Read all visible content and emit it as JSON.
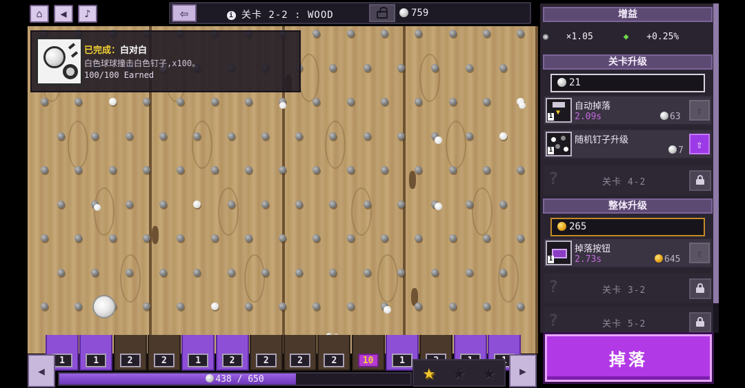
{
  "topbar": {
    "home_icon": "home-icon",
    "sound_icon": "speaker-icon",
    "music_icon": "music-note-icon",
    "back_icon": "arrow-left-icon",
    "level_title": "关卡 2-2 : WOOD",
    "ball_count": "759"
  },
  "achievement": {
    "status": "已完成：",
    "name": "白对白",
    "description": "白色球球撞击白色钉子,x100。",
    "progress": "100/100 Earned"
  },
  "board": {
    "bonus_marker": "2"
  },
  "slots": {
    "values": [
      "1",
      "1",
      "2",
      "2",
      "1",
      "2",
      "2",
      "2",
      "2",
      "10",
      "1",
      "2",
      "1",
      "1"
    ],
    "highlighted": [
      0,
      1,
      4,
      5,
      10,
      12,
      13
    ]
  },
  "progress": {
    "text": "438 / 650",
    "fraction": 0.674
  },
  "stars": {
    "earned": 1,
    "total": 3
  },
  "panel": {
    "boost_header": "增益",
    "boost_ball": "×1.05",
    "boost_gem": "+0.25%",
    "level_upgrade_header": "关卡升级",
    "level_coins": "21",
    "upgrades": [
      {
        "name": "自动掉落",
        "time": "2.09s",
        "cost": "63",
        "icon": "auto-drop-icon"
      },
      {
        "name": "随机钉子升级",
        "time": "",
        "cost": "7",
        "icon": "random-peg-icon"
      }
    ],
    "locked_level": "关卡 4-2",
    "global_upgrade_header": "整体升级",
    "global_coins": "265",
    "global_upgrades": [
      {
        "name": "掉落按钮",
        "time": "2.73s",
        "cost": "645",
        "icon": "drop-button-icon"
      }
    ],
    "locked_levels_global": [
      "关卡 3-2",
      "关卡 5-2"
    ]
  },
  "drop_button": {
    "label": "掉落"
  },
  "colors": {
    "accent": "#b23ae6",
    "panel_header": "#5d4a73",
    "wood": "#c0a172",
    "gold": "#f2c52a"
  }
}
